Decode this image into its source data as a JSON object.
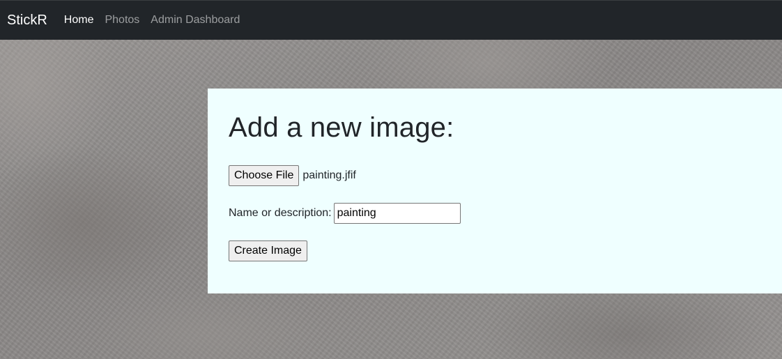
{
  "navbar": {
    "brand": "StickR",
    "links": [
      {
        "label": "Home",
        "active": true
      },
      {
        "label": "Photos",
        "active": false
      },
      {
        "label": "Admin Dashboard",
        "active": false
      }
    ]
  },
  "form": {
    "title": "Add a new image:",
    "file_button_label": "Choose File",
    "selected_file": "painting.jfif",
    "name_label": "Name or description:",
    "name_value": "painting",
    "submit_label": "Create Image"
  },
  "colors": {
    "navbar_bg": "#212529",
    "card_bg": "#efffff"
  }
}
